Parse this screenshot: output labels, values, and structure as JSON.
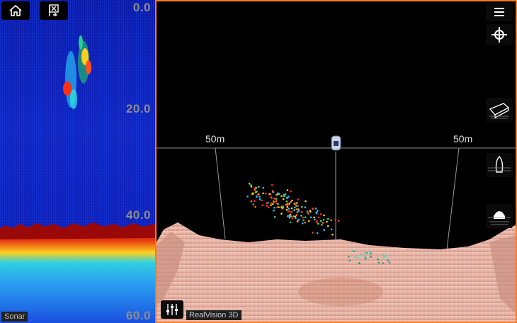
{
  "left_pane": {
    "caption": "Sonar",
    "depth_scale": [
      "0.0",
      "20.0",
      "40.0",
      "60.0"
    ],
    "buttons": {
      "home_icon": "home-icon",
      "waypoint_icon": "waypoint-flag-icon"
    }
  },
  "right_pane": {
    "caption": "RealVision 3D",
    "range_left": "50m",
    "range_right": "50m",
    "buttons": {
      "menu_icon": "hamburger-menu-icon",
      "crosshair_icon": "crosshair-icon",
      "view_perspective_icon": "boat-perspective-view-icon",
      "view_top_icon": "boat-top-view-icon",
      "view_rear_icon": "boat-rear-view-icon",
      "settings_icon": "sliders-settings-icon"
    }
  },
  "colors": {
    "active_border": "#ff7a1a",
    "sonar_background": "#0d1fb8",
    "seabed_return": "#c01010",
    "terrain": "#e8b4a8"
  }
}
